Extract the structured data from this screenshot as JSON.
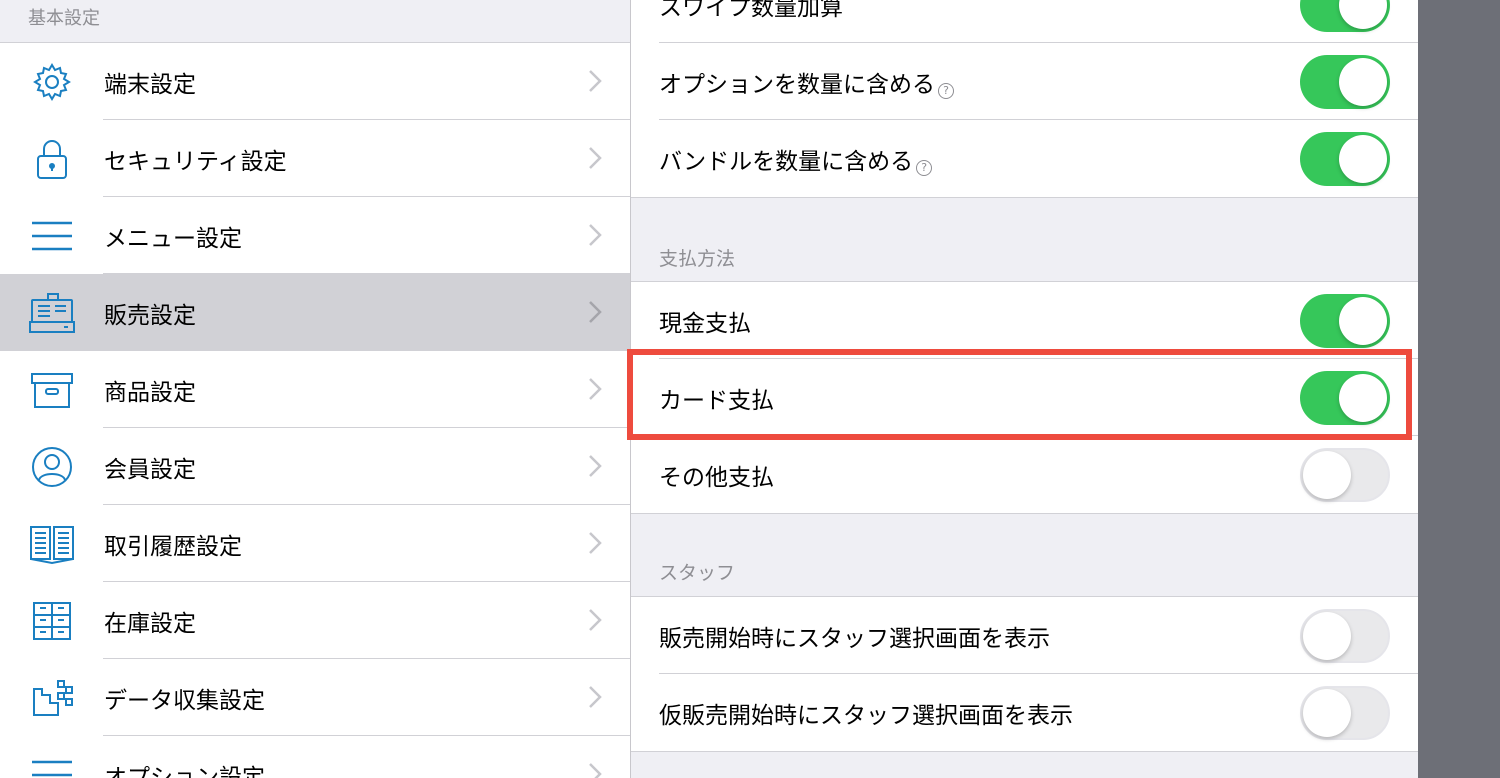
{
  "sidebar": {
    "header": "基本設定",
    "items": [
      {
        "label": "端末設定",
        "icon": "gear-icon"
      },
      {
        "label": "セキュリティ設定",
        "icon": "lock-icon"
      },
      {
        "label": "メニュー設定",
        "icon": "menu-icon"
      },
      {
        "label": "販売設定",
        "icon": "register-icon",
        "selected": true
      },
      {
        "label": "商品設定",
        "icon": "box-icon"
      },
      {
        "label": "会員設定",
        "icon": "user-icon"
      },
      {
        "label": "取引履歴設定",
        "icon": "book-icon"
      },
      {
        "label": "在庫設定",
        "icon": "inventory-icon"
      },
      {
        "label": "データ収集設定",
        "icon": "data-icon"
      },
      {
        "label": "オプション設定",
        "icon": "menu-icon"
      }
    ]
  },
  "panel": {
    "top_group": [
      {
        "label": "スワイプ数量加算",
        "on": true
      },
      {
        "label": "オプションを数量に含める",
        "help": "?",
        "on": true
      },
      {
        "label": "バンドルを数量に含める",
        "help": "?",
        "on": true
      }
    ],
    "payment": {
      "header": "支払方法",
      "rows": [
        {
          "label": "現金支払",
          "on": true
        },
        {
          "label": "カード支払",
          "on": true
        },
        {
          "label": "その他支払",
          "on": false
        }
      ]
    },
    "staff": {
      "header": "スタッフ",
      "rows": [
        {
          "label": "販売開始時にスタッフ選択画面を表示",
          "on": false
        },
        {
          "label": "仮販売開始時にスタッフ選択画面を表示",
          "on": false
        }
      ]
    }
  },
  "colors": {
    "accent_blue": "#1a7fc1",
    "toggle_on": "#36c75a",
    "highlight_red": "#ee4b3e",
    "selected_row": "#d1d1d6"
  }
}
